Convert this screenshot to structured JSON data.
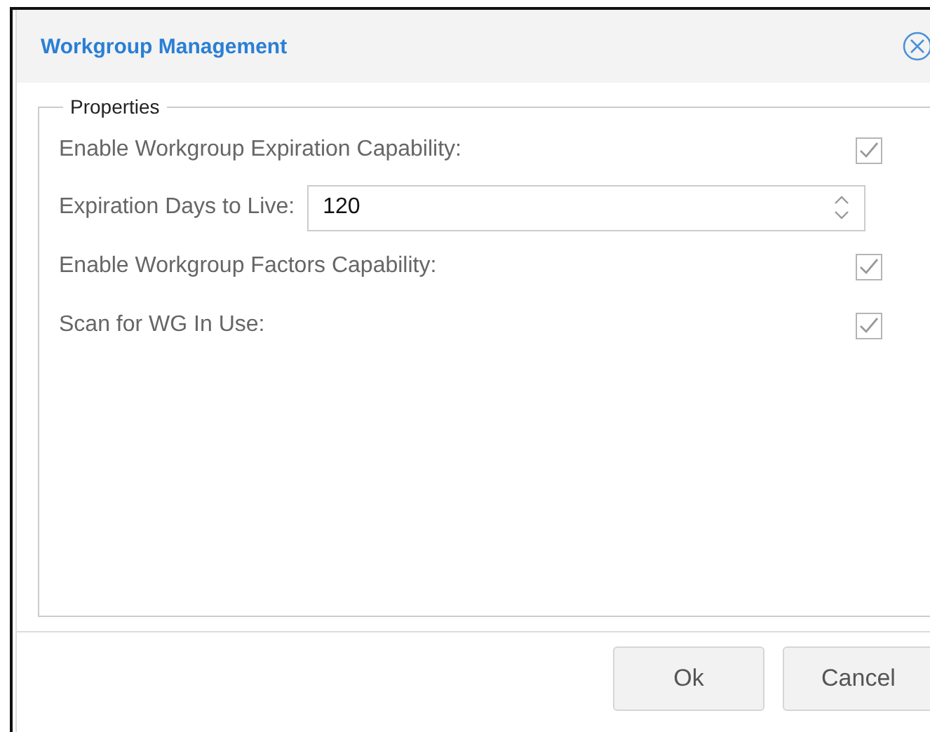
{
  "dialog": {
    "title": "Workgroup Management"
  },
  "fieldset": {
    "legend": "Properties"
  },
  "rows": [
    {
      "kind": "checkbox",
      "label": "Enable Workgroup Expiration Capability:",
      "checked": true
    },
    {
      "kind": "number",
      "label": "Expiration Days to Live:",
      "value": "120"
    },
    {
      "kind": "checkbox",
      "label": "Enable Workgroup Factors Capability:",
      "checked": true
    },
    {
      "kind": "checkbox",
      "label": "Scan for WG In Use:",
      "checked": true
    }
  ],
  "buttons": [
    "Ok",
    "Cancel"
  ]
}
